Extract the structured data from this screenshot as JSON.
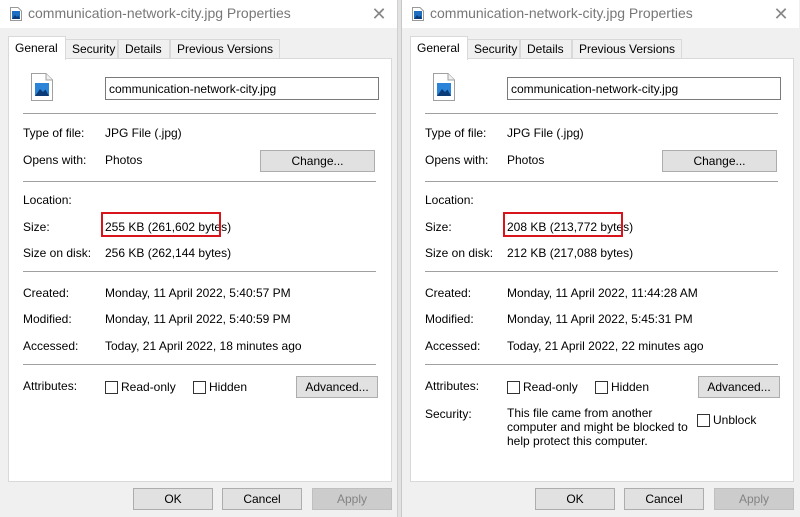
{
  "dialogs": [
    {
      "title": "communication-network-city.jpg Properties",
      "tabs": [
        "General",
        "Security",
        "Details",
        "Previous Versions"
      ],
      "active_tab": "General",
      "filename": "communication-network-city.jpg",
      "type_of_file_label": "Type of file:",
      "type_of_file": "JPG File (.jpg)",
      "opens_with_label": "Opens with:",
      "opens_with": "Photos",
      "change_button": "Change...",
      "location_label": "Location:",
      "location": "",
      "size_label": "Size:",
      "size": "255 KB (261,602 bytes)",
      "size_on_disk_label": "Size on disk:",
      "size_on_disk": "256 KB (262,144 bytes)",
      "created_label": "Created:",
      "created": "Monday, 11 April 2022, 5:40:57 PM",
      "modified_label": "Modified:",
      "modified": "Monday, 11 April 2022, 5:40:59 PM",
      "accessed_label": "Accessed:",
      "accessed": "Today, 21 April 2022, 18 minutes ago",
      "attributes_label": "Attributes:",
      "read_only_label": "Read-only",
      "read_only_checked": false,
      "hidden_label": "Hidden",
      "hidden_checked": false,
      "advanced_button": "Advanced...",
      "ok_button": "OK",
      "cancel_button": "Cancel",
      "apply_button": "Apply",
      "highlight_color": "#d8141c"
    },
    {
      "title": "communication-network-city.jpg Properties",
      "tabs": [
        "General",
        "Security",
        "Details",
        "Previous Versions"
      ],
      "active_tab": "General",
      "filename": "communication-network-city.jpg",
      "type_of_file_label": "Type of file:",
      "type_of_file": "JPG File (.jpg)",
      "opens_with_label": "Opens with:",
      "opens_with": "Photos",
      "change_button": "Change...",
      "location_label": "Location:",
      "location": "",
      "size_label": "Size:",
      "size": "208 KB (213,772 bytes)",
      "size_on_disk_label": "Size on disk:",
      "size_on_disk": "212 KB (217,088 bytes)",
      "created_label": "Created:",
      "created": "Monday, 11 April 2022, 11:44:28 AM",
      "modified_label": "Modified:",
      "modified": "Monday, 11 April 2022, 5:45:31 PM",
      "accessed_label": "Accessed:",
      "accessed": "Today, 21 April 2022, 22 minutes ago",
      "attributes_label": "Attributes:",
      "read_only_label": "Read-only",
      "read_only_checked": false,
      "hidden_label": "Hidden",
      "hidden_checked": false,
      "advanced_button": "Advanced...",
      "security_label": "Security:",
      "security_text": "This file came from another computer and might be blocked to help protect this computer.",
      "unblock_label": "Unblock",
      "unblock_checked": false,
      "ok_button": "OK",
      "cancel_button": "Cancel",
      "apply_button": "Apply",
      "highlight_color": "#d8141c"
    }
  ],
  "icons": {
    "title_icon": "image-file-icon",
    "file_icon": "jpg-image-file-icon",
    "close": "close-icon"
  }
}
